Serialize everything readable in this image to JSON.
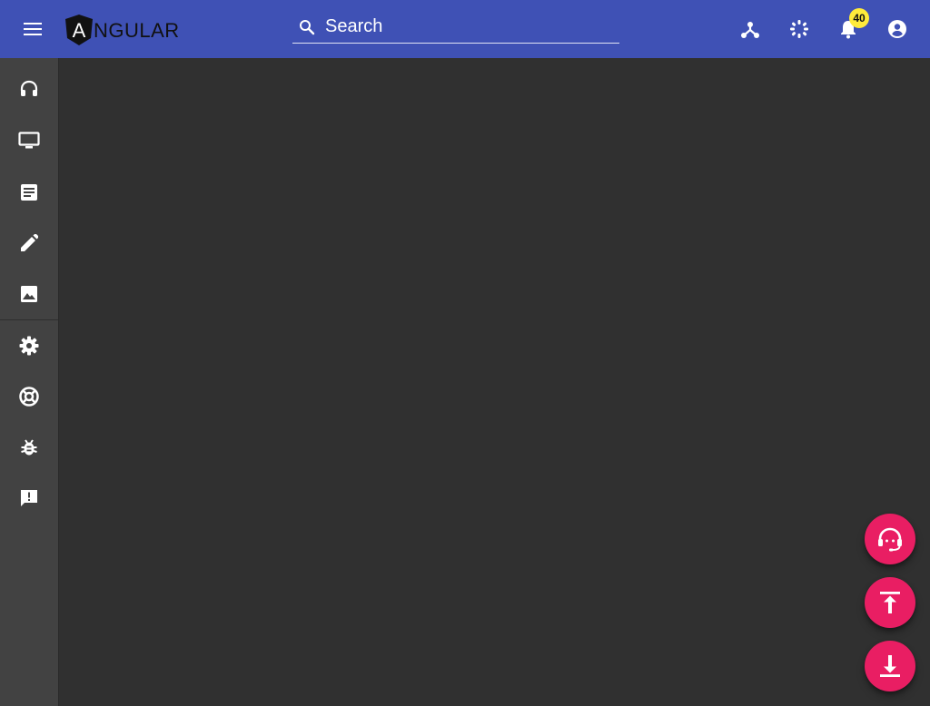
{
  "app": {
    "logo_text": "NGULAR",
    "logo_letter": "A"
  },
  "toolbar": {
    "search_placeholder": "Search",
    "notification_count": "40",
    "icons": [
      "menu-icon",
      "account-tree-icon",
      "settings-ethernet-icon",
      "notifications-icon",
      "account-circle-icon"
    ]
  },
  "sidenav": {
    "groups": [
      [
        "headset-icon",
        "desktop-icon",
        "article-icon",
        "edit-icon",
        "image-icon"
      ],
      [
        "settings-icon",
        "help-lifebuoy-icon",
        "bug-report-icon",
        "feedback-icon"
      ]
    ]
  },
  "fabs": [
    "support-agent-icon",
    "scroll-to-top-icon",
    "scroll-to-bottom-icon"
  ],
  "colors": {
    "toolbar": "#3f51b5",
    "sidenav": "#424242",
    "content": "#303030",
    "fab": "#e91e63",
    "badge": "#ffeb3b"
  }
}
